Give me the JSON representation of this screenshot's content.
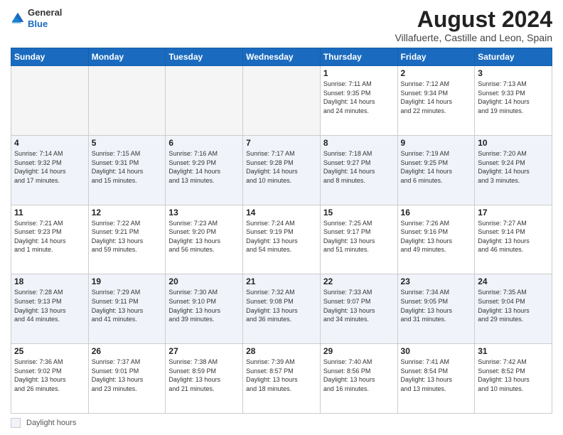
{
  "header": {
    "logo_general": "General",
    "logo_blue": "Blue",
    "title": "August 2024",
    "subtitle": "Villafuerte, Castille and Leon, Spain"
  },
  "footer": {
    "daylight_label": "Daylight hours"
  },
  "columns": [
    "Sunday",
    "Monday",
    "Tuesday",
    "Wednesday",
    "Thursday",
    "Friday",
    "Saturday"
  ],
  "weeks": [
    [
      {
        "day": "",
        "info": ""
      },
      {
        "day": "",
        "info": ""
      },
      {
        "day": "",
        "info": ""
      },
      {
        "day": "",
        "info": ""
      },
      {
        "day": "1",
        "info": "Sunrise: 7:11 AM\nSunset: 9:35 PM\nDaylight: 14 hours\nand 24 minutes."
      },
      {
        "day": "2",
        "info": "Sunrise: 7:12 AM\nSunset: 9:34 PM\nDaylight: 14 hours\nand 22 minutes."
      },
      {
        "day": "3",
        "info": "Sunrise: 7:13 AM\nSunset: 9:33 PM\nDaylight: 14 hours\nand 19 minutes."
      }
    ],
    [
      {
        "day": "4",
        "info": "Sunrise: 7:14 AM\nSunset: 9:32 PM\nDaylight: 14 hours\nand 17 minutes."
      },
      {
        "day": "5",
        "info": "Sunrise: 7:15 AM\nSunset: 9:31 PM\nDaylight: 14 hours\nand 15 minutes."
      },
      {
        "day": "6",
        "info": "Sunrise: 7:16 AM\nSunset: 9:29 PM\nDaylight: 14 hours\nand 13 minutes."
      },
      {
        "day": "7",
        "info": "Sunrise: 7:17 AM\nSunset: 9:28 PM\nDaylight: 14 hours\nand 10 minutes."
      },
      {
        "day": "8",
        "info": "Sunrise: 7:18 AM\nSunset: 9:27 PM\nDaylight: 14 hours\nand 8 minutes."
      },
      {
        "day": "9",
        "info": "Sunrise: 7:19 AM\nSunset: 9:25 PM\nDaylight: 14 hours\nand 6 minutes."
      },
      {
        "day": "10",
        "info": "Sunrise: 7:20 AM\nSunset: 9:24 PM\nDaylight: 14 hours\nand 3 minutes."
      }
    ],
    [
      {
        "day": "11",
        "info": "Sunrise: 7:21 AM\nSunset: 9:23 PM\nDaylight: 14 hours\nand 1 minute."
      },
      {
        "day": "12",
        "info": "Sunrise: 7:22 AM\nSunset: 9:21 PM\nDaylight: 13 hours\nand 59 minutes."
      },
      {
        "day": "13",
        "info": "Sunrise: 7:23 AM\nSunset: 9:20 PM\nDaylight: 13 hours\nand 56 minutes."
      },
      {
        "day": "14",
        "info": "Sunrise: 7:24 AM\nSunset: 9:19 PM\nDaylight: 13 hours\nand 54 minutes."
      },
      {
        "day": "15",
        "info": "Sunrise: 7:25 AM\nSunset: 9:17 PM\nDaylight: 13 hours\nand 51 minutes."
      },
      {
        "day": "16",
        "info": "Sunrise: 7:26 AM\nSunset: 9:16 PM\nDaylight: 13 hours\nand 49 minutes."
      },
      {
        "day": "17",
        "info": "Sunrise: 7:27 AM\nSunset: 9:14 PM\nDaylight: 13 hours\nand 46 minutes."
      }
    ],
    [
      {
        "day": "18",
        "info": "Sunrise: 7:28 AM\nSunset: 9:13 PM\nDaylight: 13 hours\nand 44 minutes."
      },
      {
        "day": "19",
        "info": "Sunrise: 7:29 AM\nSunset: 9:11 PM\nDaylight: 13 hours\nand 41 minutes."
      },
      {
        "day": "20",
        "info": "Sunrise: 7:30 AM\nSunset: 9:10 PM\nDaylight: 13 hours\nand 39 minutes."
      },
      {
        "day": "21",
        "info": "Sunrise: 7:32 AM\nSunset: 9:08 PM\nDaylight: 13 hours\nand 36 minutes."
      },
      {
        "day": "22",
        "info": "Sunrise: 7:33 AM\nSunset: 9:07 PM\nDaylight: 13 hours\nand 34 minutes."
      },
      {
        "day": "23",
        "info": "Sunrise: 7:34 AM\nSunset: 9:05 PM\nDaylight: 13 hours\nand 31 minutes."
      },
      {
        "day": "24",
        "info": "Sunrise: 7:35 AM\nSunset: 9:04 PM\nDaylight: 13 hours\nand 29 minutes."
      }
    ],
    [
      {
        "day": "25",
        "info": "Sunrise: 7:36 AM\nSunset: 9:02 PM\nDaylight: 13 hours\nand 26 minutes."
      },
      {
        "day": "26",
        "info": "Sunrise: 7:37 AM\nSunset: 9:01 PM\nDaylight: 13 hours\nand 23 minutes."
      },
      {
        "day": "27",
        "info": "Sunrise: 7:38 AM\nSunset: 8:59 PM\nDaylight: 13 hours\nand 21 minutes."
      },
      {
        "day": "28",
        "info": "Sunrise: 7:39 AM\nSunset: 8:57 PM\nDaylight: 13 hours\nand 18 minutes."
      },
      {
        "day": "29",
        "info": "Sunrise: 7:40 AM\nSunset: 8:56 PM\nDaylight: 13 hours\nand 16 minutes."
      },
      {
        "day": "30",
        "info": "Sunrise: 7:41 AM\nSunset: 8:54 PM\nDaylight: 13 hours\nand 13 minutes."
      },
      {
        "day": "31",
        "info": "Sunrise: 7:42 AM\nSunset: 8:52 PM\nDaylight: 13 hours\nand 10 minutes."
      }
    ]
  ]
}
